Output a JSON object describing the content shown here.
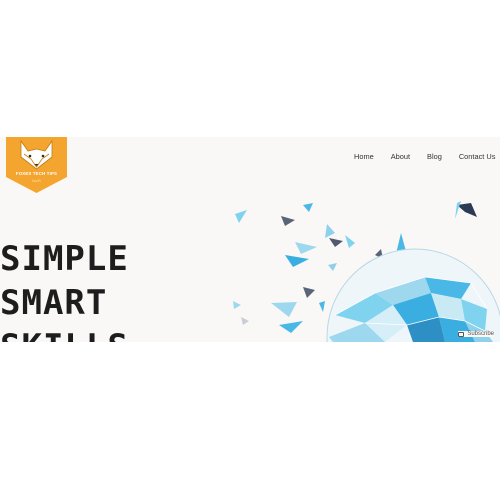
{
  "logo": {
    "name": "FOXES TECH TIPS",
    "tagline": "tech",
    "color": "#f4a52f"
  },
  "nav": {
    "items": [
      "Home",
      "About",
      "Blog",
      "Contact Us"
    ]
  },
  "hero": {
    "lines": [
      "SIMPLE",
      "SMART",
      "SKILLS"
    ]
  },
  "subscribe": {
    "label": "Subscribe",
    "icon": "subscribe-icon"
  },
  "colors": {
    "background": "#f9f8f6",
    "accent_cyan": "#38b6e8",
    "text": "#1d1d1d"
  }
}
